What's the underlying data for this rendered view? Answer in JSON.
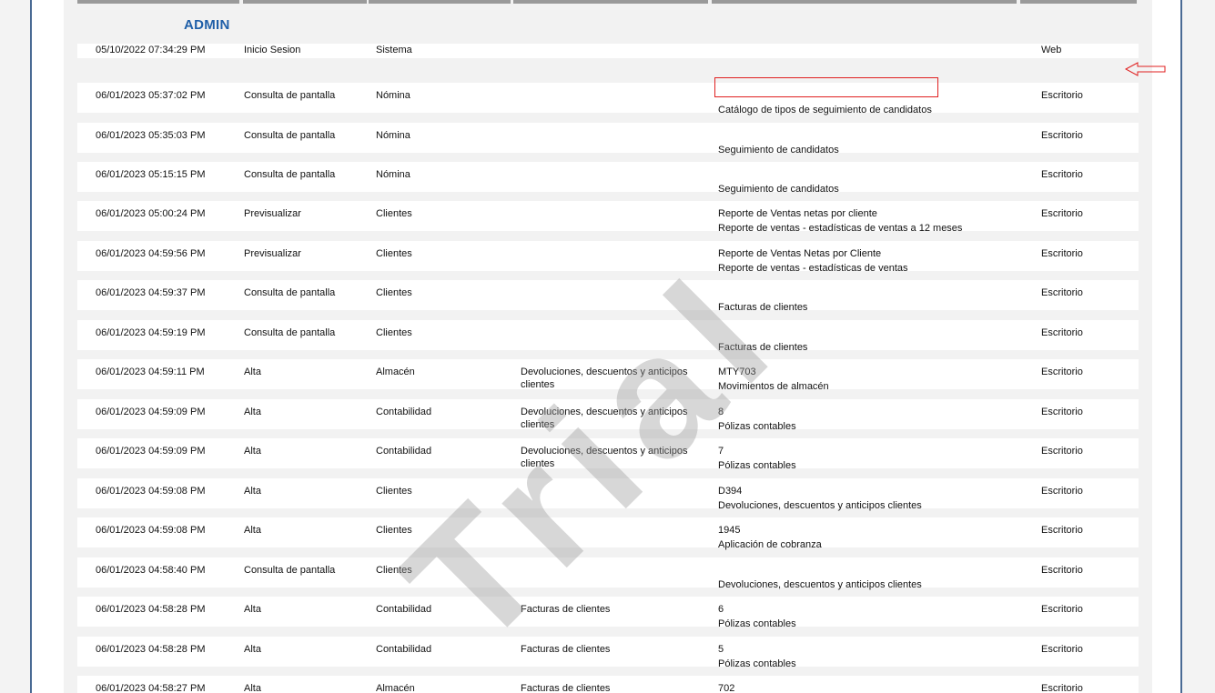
{
  "report": {
    "user_name": "ADMIN",
    "watermark": "Trial"
  },
  "rows": [
    {
      "date": "05/10/2022 07:34:29 PM",
      "action": "Inicio Sesion",
      "module": "Sistema",
      "document": "",
      "detail1": "",
      "detail2": "",
      "origin": "Web"
    },
    {
      "date": "06/01/2023 05:37:02 PM",
      "action": "Consulta de pantalla",
      "module": "Nómina",
      "document": "",
      "detail1": "",
      "detail2": "Catálogo de tipos de seguimiento de candidatos",
      "origin": "Escritorio"
    },
    {
      "date": "06/01/2023 05:35:03 PM",
      "action": "Consulta de pantalla",
      "module": "Nómina",
      "document": "",
      "detail1": "",
      "detail2": "Seguimiento de candidatos",
      "origin": "Escritorio"
    },
    {
      "date": "06/01/2023 05:15:15 PM",
      "action": "Consulta de pantalla",
      "module": "Nómina",
      "document": "",
      "detail1": "",
      "detail2": "Seguimiento de candidatos",
      "origin": "Escritorio"
    },
    {
      "date": "06/01/2023 05:00:24 PM",
      "action": "Previsualizar",
      "module": "Clientes",
      "document": "",
      "detail1": "Reporte de Ventas netas por cliente",
      "detail2": "Reporte de ventas - estadísticas de ventas a 12 meses",
      "origin": "Escritorio"
    },
    {
      "date": "06/01/2023 04:59:56 PM",
      "action": "Previsualizar",
      "module": "Clientes",
      "document": "",
      "detail1": "Reporte de Ventas Netas por Cliente",
      "detail2": "Reporte de ventas - estadísticas de ventas",
      "origin": "Escritorio"
    },
    {
      "date": "06/01/2023 04:59:37 PM",
      "action": "Consulta de pantalla",
      "module": "Clientes",
      "document": "",
      "detail1": "",
      "detail2": "Facturas de clientes",
      "origin": "Escritorio"
    },
    {
      "date": "06/01/2023 04:59:19 PM",
      "action": "Consulta de pantalla",
      "module": "Clientes",
      "document": "",
      "detail1": "",
      "detail2": "Facturas de clientes",
      "origin": "Escritorio"
    },
    {
      "date": "06/01/2023 04:59:11 PM",
      "action": "Alta",
      "module": "Almacén",
      "document": "Devoluciones, descuentos y anticipos clientes",
      "detail1": "MTY703",
      "detail2": "Movimientos de almacén",
      "origin": "Escritorio"
    },
    {
      "date": "06/01/2023 04:59:09 PM",
      "action": "Alta",
      "module": "Contabilidad",
      "document": "Devoluciones, descuentos y anticipos clientes",
      "detail1": "8",
      "detail2": "Pólizas contables",
      "origin": "Escritorio"
    },
    {
      "date": "06/01/2023 04:59:09 PM",
      "action": "Alta",
      "module": "Contabilidad",
      "document": "Devoluciones, descuentos y anticipos clientes",
      "detail1": "7",
      "detail2": "Pólizas contables",
      "origin": "Escritorio"
    },
    {
      "date": "06/01/2023 04:59:08 PM",
      "action": "Alta",
      "module": "Clientes",
      "document": "",
      "detail1": "D394",
      "detail2": "Devoluciones, descuentos y anticipos clientes",
      "origin": "Escritorio"
    },
    {
      "date": "06/01/2023 04:59:08 PM",
      "action": "Alta",
      "module": "Clientes",
      "document": "",
      "detail1": "1945",
      "detail2": "Aplicación de cobranza",
      "origin": "Escritorio"
    },
    {
      "date": "06/01/2023 04:58:40 PM",
      "action": "Consulta de pantalla",
      "module": "Clientes",
      "document": "",
      "detail1": "",
      "detail2": "Devoluciones, descuentos y anticipos clientes",
      "origin": "Escritorio"
    },
    {
      "date": "06/01/2023 04:58:28 PM",
      "action": "Alta",
      "module": "Contabilidad",
      "document": "Facturas de clientes",
      "detail1": "6",
      "detail2": "Pólizas contables",
      "origin": "Escritorio"
    },
    {
      "date": "06/01/2023 04:58:28 PM",
      "action": "Alta",
      "module": "Contabilidad",
      "document": "Facturas de clientes",
      "detail1": "5",
      "detail2": "Pólizas contables",
      "origin": "Escritorio"
    },
    {
      "date": "06/01/2023 04:58:27 PM",
      "action": "Alta",
      "module": "Almacén",
      "document": "Facturas de clientes",
      "detail1": "702",
      "detail2": "",
      "origin": "Escritorio"
    }
  ]
}
